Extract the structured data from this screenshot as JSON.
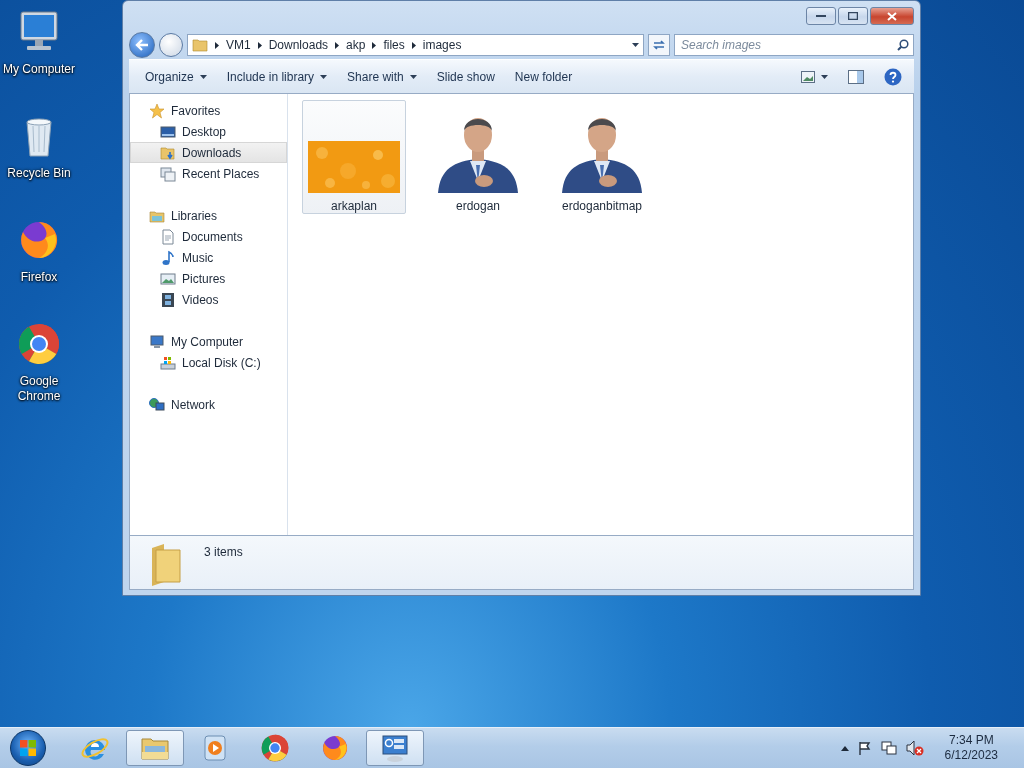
{
  "desktop_icons": [
    {
      "label": "My Computer",
      "kind": "computer"
    },
    {
      "label": "Recycle Bin",
      "kind": "recycle"
    },
    {
      "label": "Firefox",
      "kind": "firefox"
    },
    {
      "label": "Google Chrome",
      "kind": "chrome"
    }
  ],
  "window": {
    "address": {
      "crumbs": [
        "VM1",
        "Downloads",
        "akp",
        "files",
        "images"
      ]
    },
    "search": {
      "placeholder": "Search images"
    },
    "toolbar": [
      {
        "label": "Organize",
        "dropdown": true
      },
      {
        "label": "Include in library",
        "dropdown": true
      },
      {
        "label": "Share with",
        "dropdown": true
      },
      {
        "label": "Slide show",
        "dropdown": false
      },
      {
        "label": "New folder",
        "dropdown": false
      }
    ],
    "nav": [
      {
        "label": "Favorites",
        "kind": "star",
        "selected": false,
        "children": [
          {
            "label": "Desktop",
            "kind": "desktop",
            "selected": false
          },
          {
            "label": "Downloads",
            "kind": "downloads",
            "selected": true
          },
          {
            "label": "Recent Places",
            "kind": "recent",
            "selected": false
          }
        ]
      },
      {
        "label": "Libraries",
        "kind": "library",
        "selected": false,
        "children": [
          {
            "label": "Documents",
            "kind": "document",
            "selected": false
          },
          {
            "label": "Music",
            "kind": "music",
            "selected": false
          },
          {
            "label": "Pictures",
            "kind": "pictures",
            "selected": false
          },
          {
            "label": "Videos",
            "kind": "videos",
            "selected": false
          }
        ]
      },
      {
        "label": "My Computer",
        "kind": "computer",
        "selected": false,
        "children": [
          {
            "label": "Local Disk (C:)",
            "kind": "disk",
            "selected": false
          }
        ]
      },
      {
        "label": "Network",
        "kind": "network",
        "selected": false
      }
    ],
    "files": [
      {
        "name": "arkaplan",
        "kind": "pattern",
        "selected": true
      },
      {
        "name": "erdogan",
        "kind": "portrait",
        "selected": false
      },
      {
        "name": "erdoganbitmap",
        "kind": "portrait",
        "selected": false
      }
    ],
    "status": "3 items"
  },
  "taskbar": {
    "buttons": [
      {
        "kind": "ie",
        "active": false
      },
      {
        "kind": "explorer",
        "active": true
      },
      {
        "kind": "media",
        "active": false
      },
      {
        "kind": "chrome",
        "active": false
      },
      {
        "kind": "firefox",
        "active": false
      },
      {
        "kind": "control",
        "active": true
      }
    ],
    "time": "7:34 PM",
    "date": "6/12/2023"
  }
}
